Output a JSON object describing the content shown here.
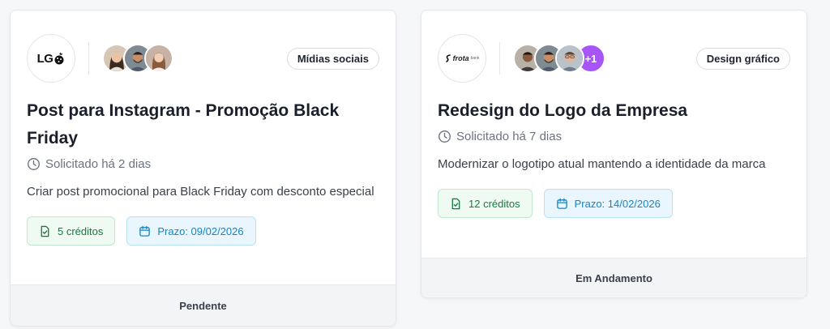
{
  "cards": [
    {
      "logo_text": "LG",
      "tag": "Mídias sociais",
      "title": "Post para Instagram - Promoção Black Friday",
      "requested": "Solicitado há 2 dias",
      "description": "Criar post promocional para Black Friday com desconto especial",
      "credits": "5 créditos",
      "deadline": "Prazo: 09/02/2026",
      "status": "Pendente",
      "avatar_icons": [
        "avatar-woman",
        "avatar-man-beard",
        "avatar-woman"
      ]
    },
    {
      "logo_text": "frota",
      "logo_sub": "bank",
      "tag": "Design gráfico",
      "title": "Redesign do Logo da Empresa",
      "requested": "Solicitado há 7 dias",
      "description": "Modernizar o logotipo atual mantendo a identidade da marca",
      "credits": "12 créditos",
      "deadline": "Prazo: 14/02/2026",
      "status": "Em Andamento",
      "more_count": "+1",
      "avatar_icons": [
        "avatar-man",
        "avatar-man-beard",
        "avatar-man-glasses"
      ]
    }
  ],
  "colors": {
    "credits_bg": "#effaf2",
    "credits_text": "#167a3e",
    "deadline_bg": "#eaf6fd",
    "deadline_text": "#1585c4",
    "more_avatar": "#a855f7"
  }
}
